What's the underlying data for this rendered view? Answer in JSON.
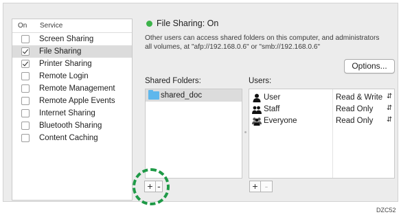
{
  "services": {
    "col_on": "On",
    "col_service": "Service",
    "items": [
      {
        "label": "Screen Sharing",
        "checked": false,
        "selected": false
      },
      {
        "label": "File Sharing",
        "checked": true,
        "selected": true
      },
      {
        "label": "Printer Sharing",
        "checked": true,
        "selected": false
      },
      {
        "label": "Remote Login",
        "checked": false,
        "selected": false
      },
      {
        "label": "Remote Management",
        "checked": false,
        "selected": false
      },
      {
        "label": "Remote Apple Events",
        "checked": false,
        "selected": false
      },
      {
        "label": "Internet Sharing",
        "checked": false,
        "selected": false
      },
      {
        "label": "Bluetooth Sharing",
        "checked": false,
        "selected": false
      },
      {
        "label": "Content Caching",
        "checked": false,
        "selected": false
      }
    ]
  },
  "status": {
    "text": "File Sharing: On",
    "color": "#3cb34a",
    "description_line1": "Other users can access shared folders on this computer, and administrators",
    "description_line2": "all volumes, at \"afp://192.168.0.6\" or \"smb://192.168.0.6\""
  },
  "options_label": "Options...",
  "shared_folders": {
    "label": "Shared Folders:",
    "items": [
      "shared_doc"
    ]
  },
  "users": {
    "label": "Users:",
    "items": [
      {
        "name": "User",
        "icon": "single-user-icon",
        "permission": "Read & Write"
      },
      {
        "name": "Staff",
        "icon": "group-user-icon",
        "permission": "Read Only"
      },
      {
        "name": "Everyone",
        "icon": "everyone-users-icon",
        "permission": "Read Only"
      }
    ]
  },
  "buttons": {
    "plus": "+",
    "minus": "-"
  },
  "highlight_color": "#1f9a47",
  "figure_code": "DZC52"
}
